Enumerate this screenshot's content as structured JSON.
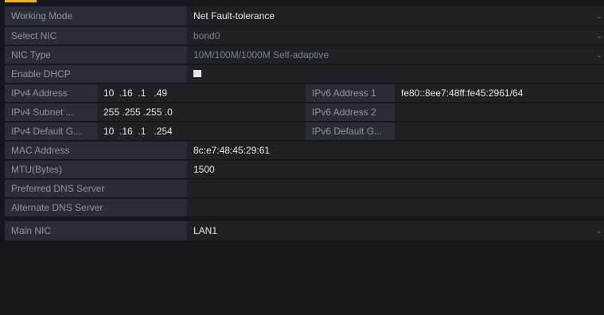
{
  "form": {
    "working_mode": {
      "label": "Working Mode",
      "value": "Net Fault-tolerance"
    },
    "select_nic": {
      "label": "Select NIC",
      "value": "bond0"
    },
    "nic_type": {
      "label": "NIC Type",
      "value": "10M/100M/1000M Self-adaptive"
    },
    "enable_dhcp": {
      "label": "Enable DHCP",
      "checked": true
    },
    "ipv4_address": {
      "label": "IPv4 Address",
      "value": "10  .16  .1   .49"
    },
    "ipv4_subnet": {
      "label": "IPv4 Subnet ...",
      "value": "255 .255 .255 .0"
    },
    "ipv4_gateway": {
      "label": "IPv4 Default G...",
      "value": "10  .16  .1   .254"
    },
    "ipv6_address1": {
      "label": "IPv6 Address 1",
      "value": "fe80::8ee7:48ff:fe45:2961/64"
    },
    "ipv6_address2": {
      "label": "IPv6 Address 2",
      "value": ""
    },
    "ipv6_gateway": {
      "label": "IPv6 Default G...",
      "value": ""
    },
    "mac_address": {
      "label": "MAC Address",
      "value": "8c:e7:48:45:29:61"
    },
    "mtu": {
      "label": "MTU(Bytes)",
      "value": "1500"
    },
    "preferred_dns": {
      "label": "Preferred DNS Server",
      "value": ""
    },
    "alternate_dns": {
      "label": "Alternate DNS Server",
      "value": ""
    },
    "main_nic": {
      "label": "Main NIC",
      "value": "LAN1"
    }
  },
  "icons": {
    "dropdown": "chevron-down-icon",
    "checkbox": "checkbox-icon"
  },
  "colors": {
    "accent": "#e8b923",
    "background": "#15171c",
    "row": "#25272e"
  }
}
